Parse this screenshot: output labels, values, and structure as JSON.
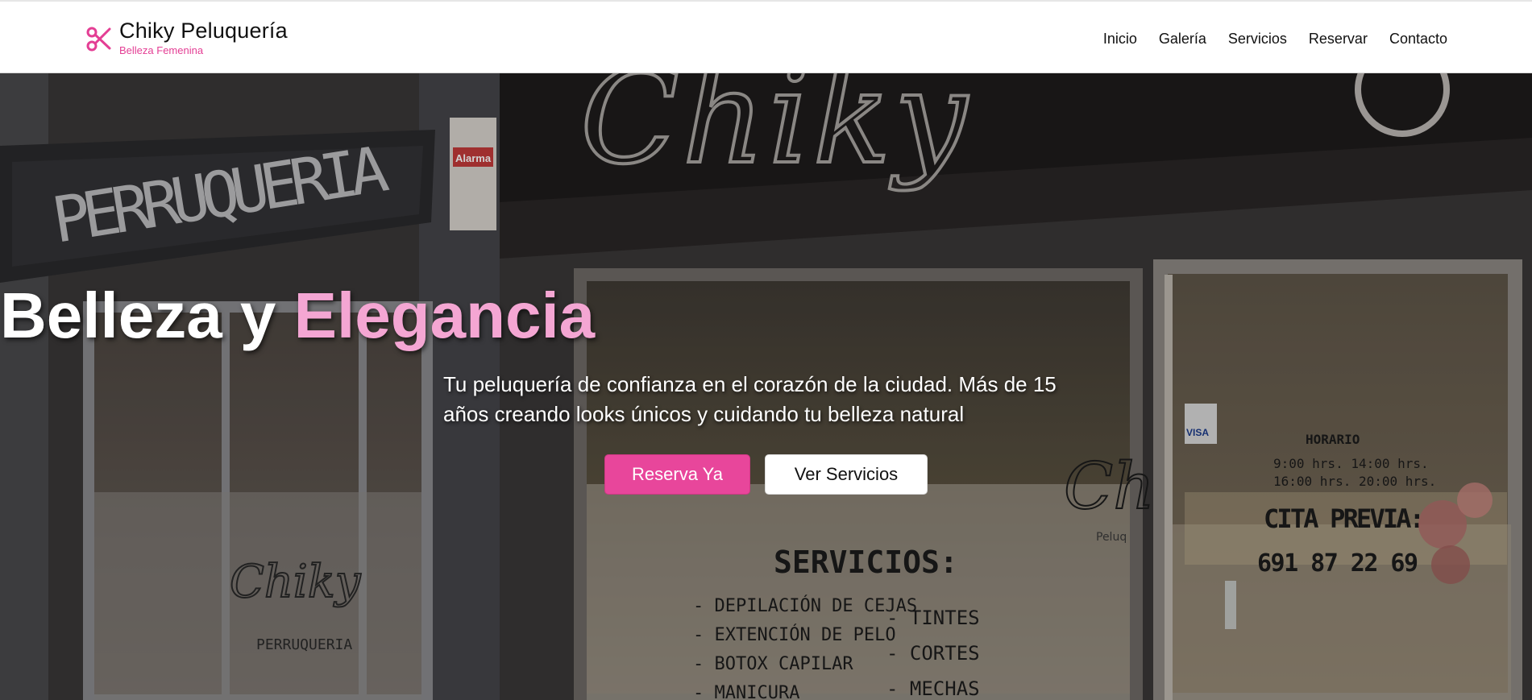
{
  "brand": {
    "name": "Chiky Peluquería",
    "tagline": "Belleza Femenina",
    "icon": "scissors-icon",
    "accent_color": "#e43e94"
  },
  "nav": {
    "items": [
      {
        "label": "Inicio"
      },
      {
        "label": "Galería"
      },
      {
        "label": "Servicios"
      },
      {
        "label": "Reservar"
      },
      {
        "label": "Contacto"
      }
    ]
  },
  "hero": {
    "title_main": "Belleza y",
    "title_accent": "Elegancia",
    "title_accent_color": "#f4a6d3",
    "subtitle": "Tu peluquería de confianza en el corazón de la ciudad. Más de 15 años creando looks únicos y cuidando tu belleza natural",
    "primary_button": "Reserva Ya",
    "primary_button_color": "#e8469b",
    "secondary_button": "Ver Servicios"
  },
  "storefront": {
    "sign_left": "PERRUQUERIA",
    "sign_main": "Chiky",
    "alarm_label": "Alarma",
    "glass_logo": "Chiky",
    "glass_sub": "PERRUQUERIA",
    "services_title": "SERVICIOS:",
    "services_left": [
      "- DEPILACIÓN DE CEJAS",
      "- EXTENCIÓN DE PELO",
      "- BOTOX CAPILAR",
      "- MANICURA"
    ],
    "services_right": [
      "- TINTES",
      "- CORTES",
      "- MECHAS"
    ],
    "door_logo": "Chi",
    "door_logo_sub": "Peluq",
    "horario_title": "HORARIO",
    "horario_line1": "9:00 hrs. 14:00 hrs.",
    "horario_line2": "16:00 hrs. 20:00 hrs.",
    "cita_title": "CITA PREVIA:",
    "phone": "691 87 22 69",
    "card_label": "VISA"
  }
}
